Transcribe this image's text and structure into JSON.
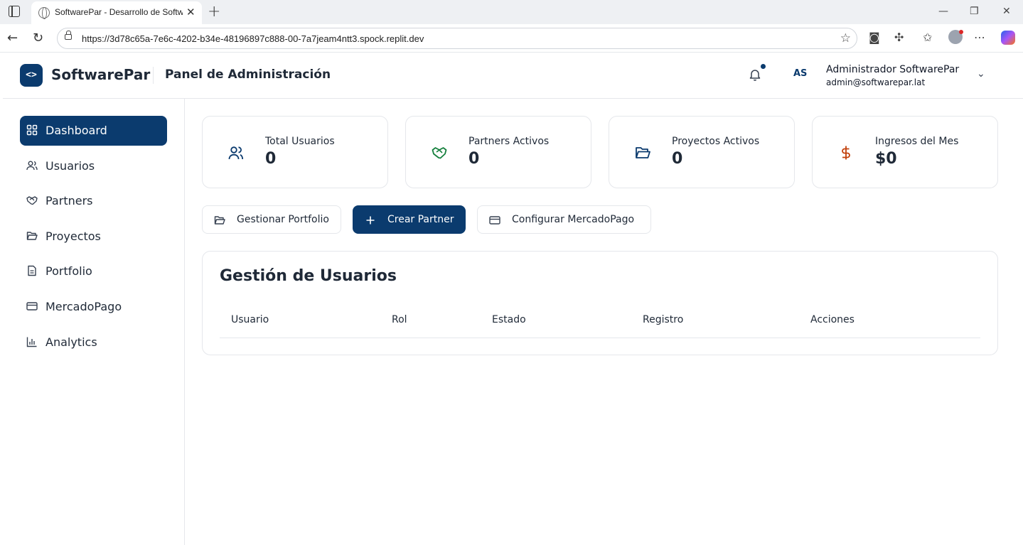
{
  "browser": {
    "tab_title": "SoftwarePar - Desarrollo de Software",
    "url": "https://3d78c65a-7e6c-4202-b34e-48196897c888-00-7a7jeam4ntt3.spock.replit.dev"
  },
  "header": {
    "logo_glyph": "<>",
    "brand": "SoftwarePar",
    "panel_title": "Panel de Administración",
    "avatar_initials": "AS",
    "user_name": "Administrador SoftwarePar",
    "user_email": "admin@softwarepar.lat",
    "notification_dot_color": "#0b3b6e"
  },
  "sidebar": {
    "items": [
      {
        "label": "Dashboard",
        "icon": "grid-icon",
        "active": true
      },
      {
        "label": "Usuarios",
        "icon": "users-icon"
      },
      {
        "label": "Partners",
        "icon": "handshake-icon"
      },
      {
        "label": "Proyectos",
        "icon": "folder-icon"
      },
      {
        "label": "Portfolio",
        "icon": "file-icon"
      },
      {
        "label": "MercadoPago",
        "icon": "card-icon"
      },
      {
        "label": "Analytics",
        "icon": "bar-chart-icon"
      }
    ]
  },
  "stats": [
    {
      "label": "Total Usuarios",
      "value": "0",
      "icon": "users-icon",
      "color": "#0b3b6e"
    },
    {
      "label": "Partners Activos",
      "value": "0",
      "icon": "handshake-icon",
      "color": "#15803d"
    },
    {
      "label": "Proyectos Activos",
      "value": "0",
      "icon": "folder-icon",
      "color": "#0b3b6e"
    },
    {
      "label": "Ingresos del Mes",
      "value": "$0",
      "icon": "dollar-icon",
      "color": "#c2410c"
    }
  ],
  "actions": [
    {
      "label": "Gestionar Portfolio",
      "icon": "folder-icon"
    },
    {
      "label": "Crear Partner",
      "icon": "plus-icon"
    },
    {
      "label": "Configurar MercadoPago",
      "icon": "card-icon"
    }
  ],
  "users_section": {
    "title": "Gestión de Usuarios",
    "columns": [
      "Usuario",
      "Rol",
      "Estado",
      "Registro",
      "Acciones"
    ]
  },
  "colors": {
    "primary": "#0b3b6e",
    "border": "#e5e7eb"
  }
}
